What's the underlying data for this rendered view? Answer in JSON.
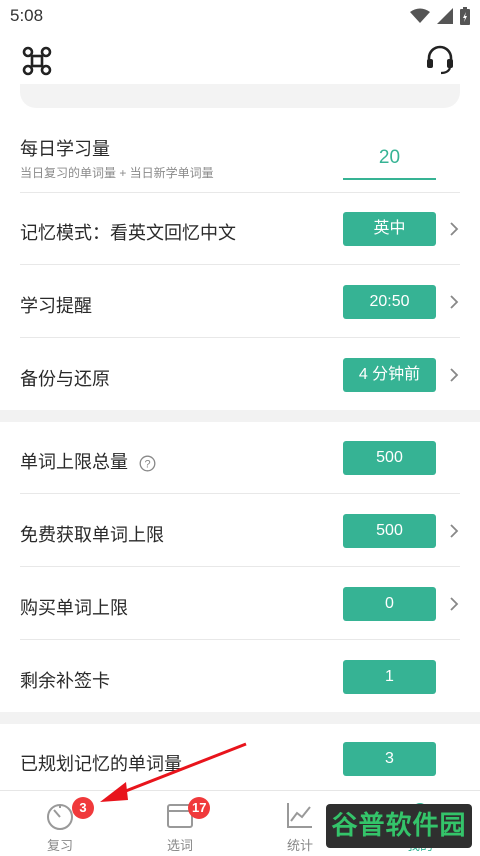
{
  "status_bar": {
    "time": "5:08"
  },
  "daily": {
    "label": "每日学习量",
    "sublabel": "当日复习的单词量 + 当日新学单词量",
    "value": "20"
  },
  "settings_group1": [
    {
      "label": "记忆模式：看英文回忆中文",
      "value": "英中",
      "chevron": true
    },
    {
      "label": "学习提醒",
      "value": "20:50",
      "chevron": true
    },
    {
      "label": "备份与还原",
      "value": "4 分钟前",
      "chevron": true
    }
  ],
  "settings_group2": [
    {
      "label": "单词上限总量",
      "value": "500",
      "chevron": false,
      "help": true
    },
    {
      "label": "免费获取单词上限",
      "value": "500",
      "chevron": true
    },
    {
      "label": "购买单词上限",
      "value": "0",
      "chevron": true
    },
    {
      "label": "剩余补签卡",
      "value": "1",
      "chevron": false
    }
  ],
  "planned": {
    "label": "已规划记忆的单词量",
    "value": "3"
  },
  "tabs": [
    {
      "label": "复习",
      "badge": "3"
    },
    {
      "label": "选词",
      "badge": "17"
    },
    {
      "label": "统计",
      "badge": ""
    },
    {
      "label": "我的",
      "badge": ""
    }
  ],
  "watermark": {
    "text": "谷普软件园"
  },
  "colors": {
    "accent": "#36b394",
    "badge": "#f0393b",
    "arrow": "#e8141c",
    "watermark_text": "#34c46a"
  }
}
